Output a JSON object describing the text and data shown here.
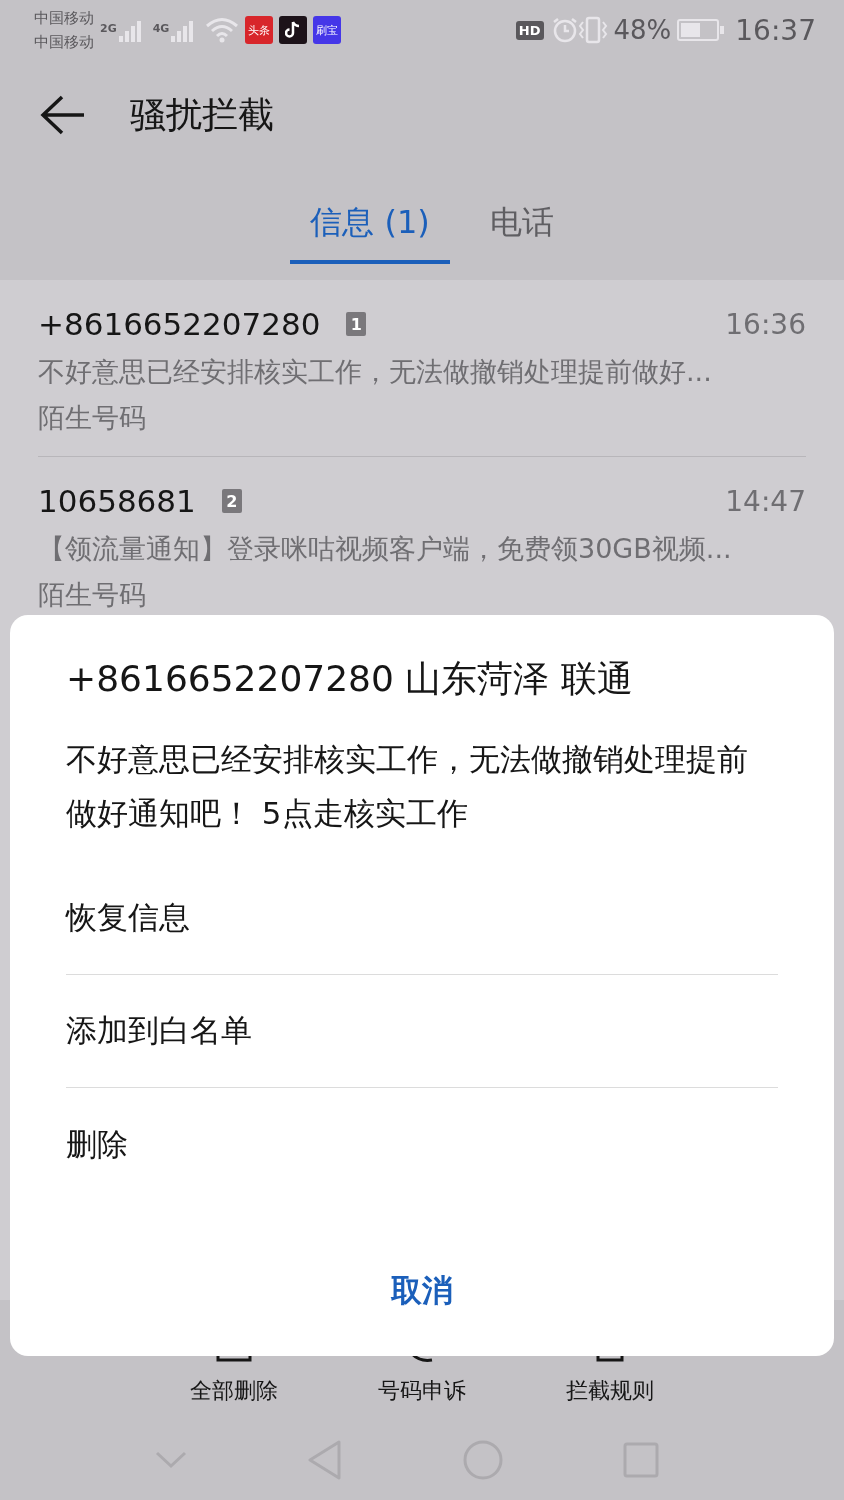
{
  "status_bar": {
    "carriers": [
      "中国移动",
      "中国移动"
    ],
    "networks": [
      "2G",
      "4G"
    ],
    "notifications": [
      {
        "kind": "toutiao",
        "label": "头条"
      },
      {
        "kind": "tiktok"
      },
      {
        "kind": "shuabao",
        "label": "刷宝"
      }
    ],
    "hd": "HD",
    "battery": "48%",
    "time": "16:37"
  },
  "header": {
    "title": "骚扰拦截"
  },
  "tabs": [
    {
      "label": "信息 (1)",
      "selected": true
    },
    {
      "label": "电话",
      "selected": false
    }
  ],
  "messages": [
    {
      "sender": "+8616652207280",
      "sim": "1",
      "time": "16:36",
      "preview": "不好意思已经安排核实工作，无法做撤销处理提前做好...",
      "tag": "陌生号码"
    },
    {
      "sender": "10658681",
      "sim": "2",
      "time": "14:47",
      "preview": "【领流量通知】登录咪咕视频客户端，免费领30GB视频...",
      "tag": "陌生号码"
    }
  ],
  "toolbar": [
    {
      "kind": "delete-all",
      "label": "全部删除"
    },
    {
      "kind": "appeal",
      "label": "号码申诉"
    },
    {
      "kind": "rules",
      "label": "拦截规则"
    }
  ],
  "dialog": {
    "title": "+8616652207280 山东菏泽 联通",
    "body": "不好意思已经安排核实工作，无法做撤销处理提前做好通知吧！ 5点走核实工作",
    "options": [
      "恢复信息",
      "添加到白名单",
      "删除"
    ],
    "cancel": "取消"
  }
}
